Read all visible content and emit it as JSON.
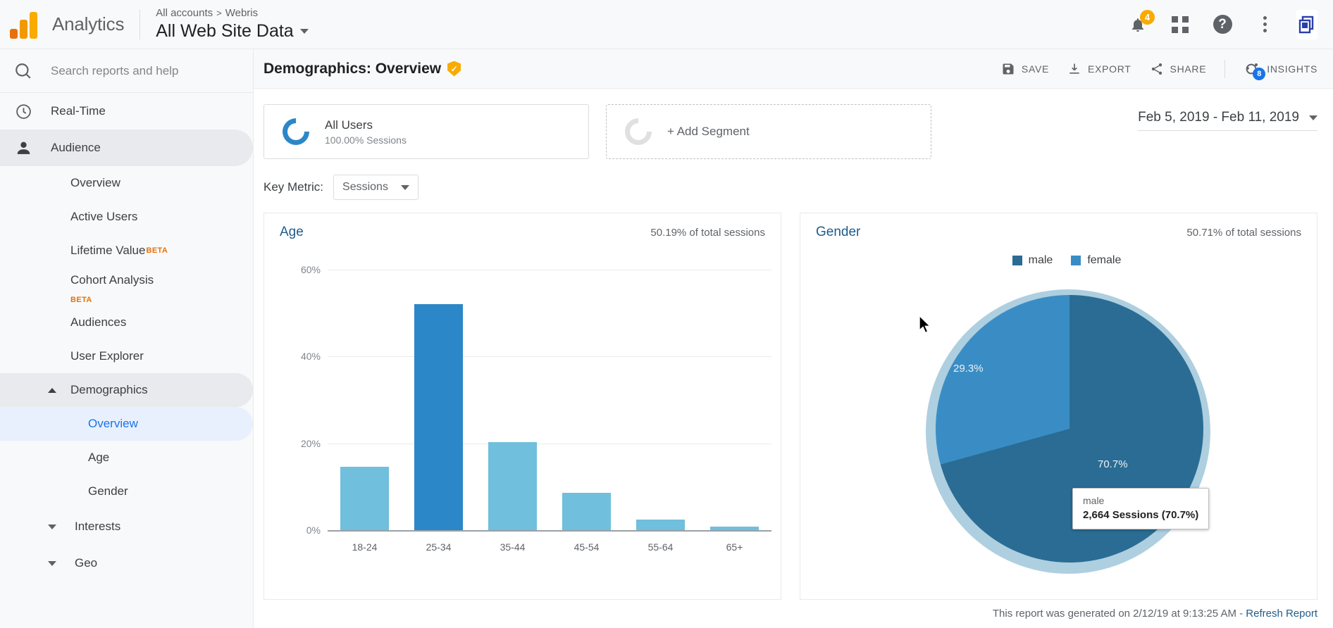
{
  "topbar": {
    "brand": "Analytics",
    "breadcrumb_root": "All accounts",
    "breadcrumb_sep": ">",
    "breadcrumb_account": "Webris",
    "property_title": "All Web Site Data",
    "notifications_badge": "4",
    "icons": {
      "bell": "notifications-icon",
      "apps": "apps-grid-icon",
      "help": "?",
      "more": "more-vertical-icon",
      "avatar": "account-logo-icon"
    }
  },
  "sidebar": {
    "search_placeholder": "Search reports and help",
    "realtime_label": "Real-Time",
    "audience_label": "Audience",
    "items": [
      {
        "label": "Overview"
      },
      {
        "label": "Active Users"
      },
      {
        "label": "Lifetime Value",
        "beta": "BETA"
      },
      {
        "label": "Cohort Analysis",
        "beta": "BETA"
      },
      {
        "label": "Audiences"
      },
      {
        "label": "User Explorer"
      }
    ],
    "demographics_label": "Demographics",
    "demographics_children": [
      {
        "label": "Overview",
        "active": true
      },
      {
        "label": "Age",
        "active": false
      },
      {
        "label": "Gender",
        "active": false
      }
    ],
    "groups": [
      {
        "label": "Interests"
      },
      {
        "label": "Geo"
      }
    ]
  },
  "report": {
    "title": "Demographics: Overview",
    "verified_glyph": "✓",
    "actions": [
      {
        "label": "SAVE",
        "icon": "save-icon"
      },
      {
        "label": "EXPORT",
        "icon": "export-icon"
      },
      {
        "label": "SHARE",
        "icon": "share-icon"
      },
      {
        "label": "INSIGHTS",
        "icon": "insights-icon",
        "badge": "8"
      }
    ]
  },
  "segments": {
    "primary_name": "All Users",
    "primary_sub": "100.00% Sessions",
    "add_label": "+ Add Segment"
  },
  "daterange": {
    "value": "Feb 5, 2019 - Feb 11, 2019"
  },
  "keymetric": {
    "label": "Key Metric:",
    "value": "Sessions"
  },
  "footer": {
    "text": "This report was generated on 2/12/19 at 9:13:25 AM - ",
    "link": "Refresh Report"
  },
  "chart_data": [
    {
      "type": "bar",
      "title": "Age",
      "subtitle": "50.19% of total sessions",
      "categories": [
        "18-24",
        "25-34",
        "35-44",
        "45-54",
        "55-64",
        "65+"
      ],
      "values": [
        14.6,
        52.1,
        20.3,
        8.6,
        2.4,
        0.8
      ],
      "highlighted_index": 1,
      "xlabel": "",
      "ylabel": "",
      "ylim": [
        0,
        60
      ],
      "yticks": [
        0,
        20,
        40,
        60
      ],
      "ytick_labels": [
        "0%",
        "20%",
        "40%",
        "60%"
      ],
      "grid": true,
      "colors": {
        "bar": "#6fbfdd",
        "bar_highlight": "#2b87c8"
      }
    },
    {
      "type": "pie",
      "title": "Gender",
      "subtitle": "50.71% of total sessions",
      "legend_position": "top",
      "labels": [
        "male",
        "female"
      ],
      "values": [
        70.7,
        29.3
      ],
      "value_labels": [
        "70.7%",
        "29.3%"
      ],
      "colors": [
        "#2a6c94",
        "#3a8dc4"
      ],
      "highlight_ring_color": "#aecfe0",
      "tooltip": {
        "label": "male",
        "value": "2,664 Sessions (70.7%)"
      }
    }
  ]
}
